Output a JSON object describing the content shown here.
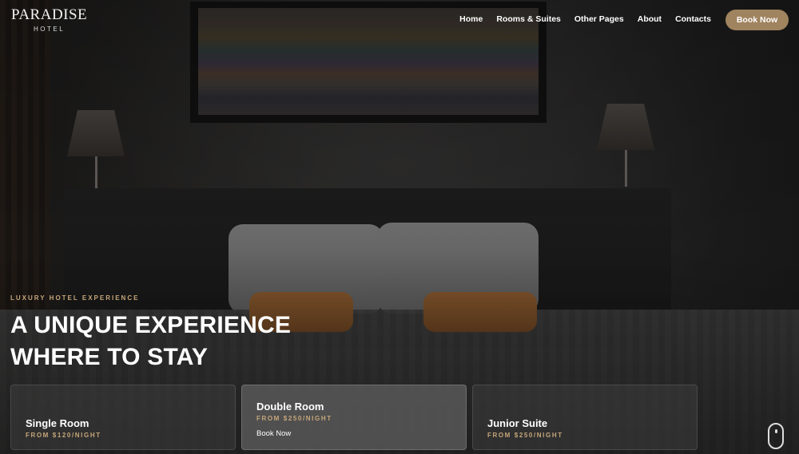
{
  "brand": {
    "name": "PARADISE",
    "tagline": "HOTEL"
  },
  "nav": {
    "items": [
      {
        "label": "Home"
      },
      {
        "label": "Rooms & Suites"
      },
      {
        "label": "Other Pages"
      },
      {
        "label": "About"
      },
      {
        "label": "Contacts"
      }
    ],
    "cta_label": "Book Now"
  },
  "hero": {
    "eyebrow": "LUXURY HOTEL EXPERIENCE",
    "headline_line1": "A UNIQUE EXPERIENCE",
    "headline_line2": "WHERE TO STAY"
  },
  "rooms": [
    {
      "title": "Single Room",
      "price": "FROM $120/NIGHT"
    },
    {
      "title": "Double Room",
      "price": "FROM $250/NIGHT",
      "link": "Book Now"
    },
    {
      "title": "Junior Suite",
      "price": "FROM $250/NIGHT"
    }
  ],
  "colors": {
    "accent": "#a0835f",
    "accent_text": "#c6a67a",
    "background": "#1f1f1f"
  },
  "icons": {
    "scroll": "mouse-scroll-icon"
  }
}
